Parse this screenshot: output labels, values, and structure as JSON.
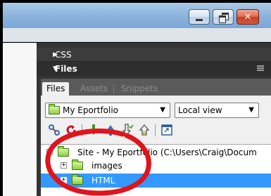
{
  "window": {
    "buttons": {
      "minimize": "minimize-icon",
      "maximize": "restore-icon",
      "close": "✕"
    }
  },
  "panels": {
    "css_header": "CSS",
    "files_header": "Files"
  },
  "tabs": [
    {
      "label": "Files",
      "active": true
    },
    {
      "label": "Assets",
      "active": false
    },
    {
      "label": "Snippets",
      "active": false
    }
  ],
  "site_select": {
    "value": "My Eportfolio"
  },
  "view_select": {
    "value": "Local view"
  },
  "toolbar": {
    "icons": [
      "connect-icon",
      "refresh-icon",
      "get-files-icon",
      "put-files-icon",
      "check-out-icon",
      "check-in-icon",
      "expand-icon"
    ]
  },
  "tree": {
    "root": {
      "label": "Site - My Eportfolio (C:\\Users\\Craig\\Docum"
    },
    "children": [
      {
        "label": "images",
        "selected": false
      },
      {
        "label": "HTML",
        "selected": true
      }
    ]
  },
  "colors": {
    "selection": "#3399ff",
    "annotation": "#e0141b",
    "folder": "#8fd13d",
    "panel_dark": "#343434"
  }
}
